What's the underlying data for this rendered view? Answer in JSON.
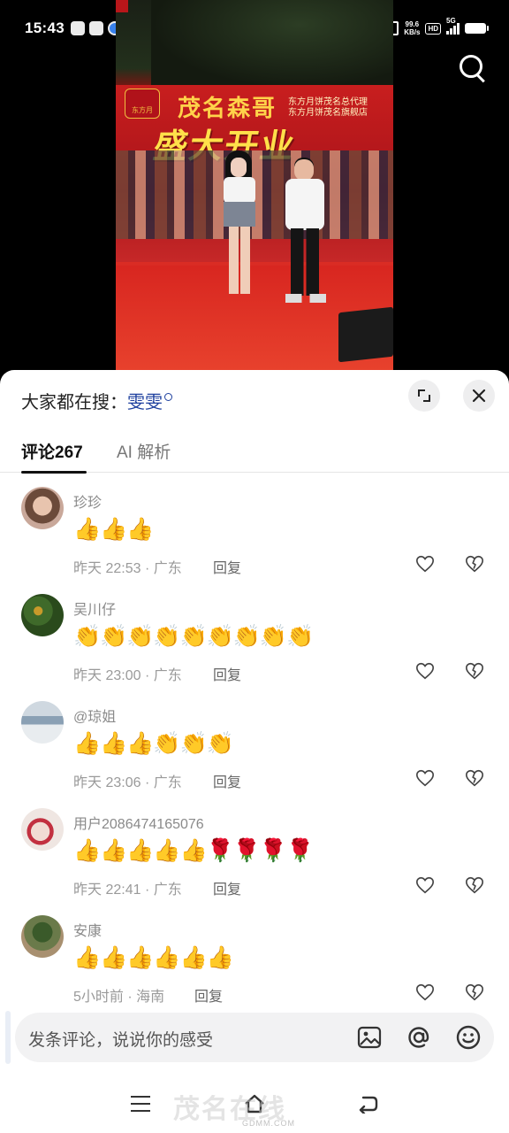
{
  "status_bar": {
    "time": "15:43",
    "net_speed_value": "99.6",
    "net_speed_unit": "KB/s",
    "hd_label": "HD",
    "network": "5G",
    "battery_level": 0.95
  },
  "video": {
    "banner_title": "茂名森哥",
    "banner_subtitle_line1": "东方月饼茂名总代理",
    "banner_subtitle_line2": "东方月饼茂名旗舰店",
    "banner_headline": "盛大开业",
    "banner_logo": "东方月"
  },
  "sheet": {
    "hot_search_label": "大家都在搜：",
    "hot_search_keyword": "雯雯"
  },
  "tabs": {
    "comments_label": "评论",
    "comments_count": "267",
    "ai_label": "AI 解析"
  },
  "comments": [
    {
      "user": "珍珍",
      "content": "👍👍👍",
      "time": "昨天 22:53",
      "location": "广东",
      "reply": "回复"
    },
    {
      "user": "吴川仔",
      "content": "👏👏👏👏👏👏👏👏👏",
      "time": "昨天 23:00",
      "location": "广东",
      "reply": "回复"
    },
    {
      "user": "@琼姐",
      "content": "👍👍👍👏👏👏",
      "time": "昨天 23:06",
      "location": "广东",
      "reply": "回复"
    },
    {
      "user": "用户2086474165076",
      "content": "👍👍👍👍👍🌹🌹🌹🌹",
      "time": "昨天 22:41",
      "location": "广东",
      "reply": "回复"
    },
    {
      "user": "安康",
      "content": "👍👍👍👍👍👍",
      "time": "5小时前",
      "location": "海南",
      "reply": "回复"
    }
  ],
  "composer": {
    "placeholder": "发条评论，说说你的感受"
  },
  "watermark": {
    "text": "GDMM.COM",
    "mark": "茂名在线"
  },
  "colors": {
    "keyword": "#1d3f9e",
    "text_primary": "#222222",
    "text_secondary": "#8a8a8a",
    "sheet_bg": "#ffffff",
    "input_bg": "#f2f2f3"
  }
}
